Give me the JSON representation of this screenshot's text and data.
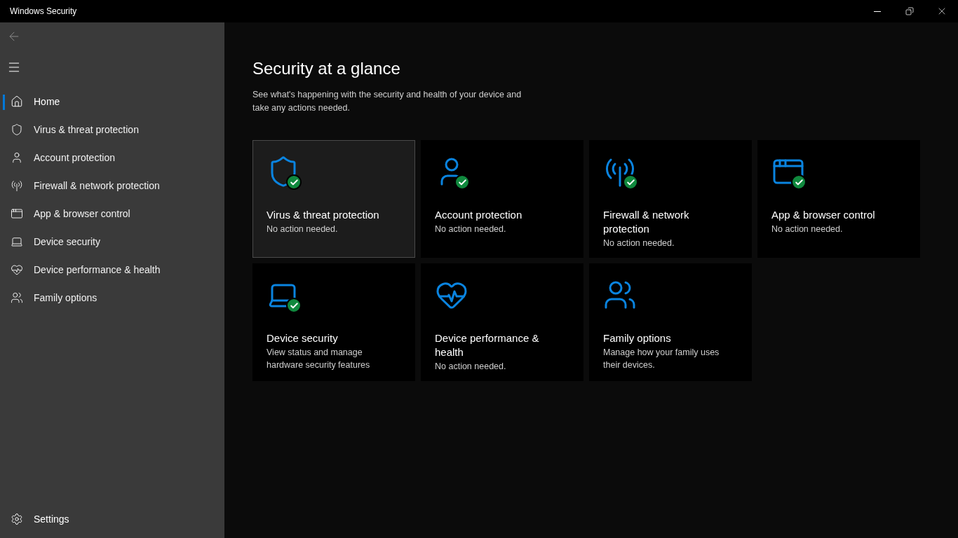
{
  "window": {
    "title": "Windows Security"
  },
  "sidebar": {
    "items": [
      {
        "kind": "home",
        "label": "Home",
        "selected": true
      },
      {
        "kind": "shield",
        "label": "Virus & threat protection",
        "selected": false
      },
      {
        "kind": "person",
        "label": "Account protection",
        "selected": false
      },
      {
        "kind": "antenna",
        "label": "Firewall & network protection",
        "selected": false
      },
      {
        "kind": "window",
        "label": "App & browser control",
        "selected": false
      },
      {
        "kind": "laptop",
        "label": "Device security",
        "selected": false
      },
      {
        "kind": "heart",
        "label": "Device performance & health",
        "selected": false
      },
      {
        "kind": "family",
        "label": "Family options",
        "selected": false
      }
    ],
    "settings": {
      "label": "Settings"
    }
  },
  "main": {
    "title": "Security at a glance",
    "description": "See what's happening with the security and health of your device and take any actions needed.",
    "tiles": [
      {
        "kind": "shield",
        "title": "Virus & threat protection",
        "status": "No action needed.",
        "ok": true,
        "selected": true
      },
      {
        "kind": "person",
        "title": "Account protection",
        "status": "No action needed.",
        "ok": true,
        "selected": false
      },
      {
        "kind": "antenna",
        "title": "Firewall & network protection",
        "status": "No action needed.",
        "ok": true,
        "selected": false
      },
      {
        "kind": "window",
        "title": "App & browser control",
        "status": "No action needed.",
        "ok": true,
        "selected": false
      },
      {
        "kind": "laptop",
        "title": "Device security",
        "status": "View status and manage hardware security features",
        "ok": true,
        "selected": false
      },
      {
        "kind": "heart",
        "title": "Device performance & health",
        "status": "No action needed.",
        "ok": false,
        "selected": false
      },
      {
        "kind": "family",
        "title": "Family options",
        "status": "Manage how your family uses their devices.",
        "ok": false,
        "selected": false
      }
    ]
  }
}
